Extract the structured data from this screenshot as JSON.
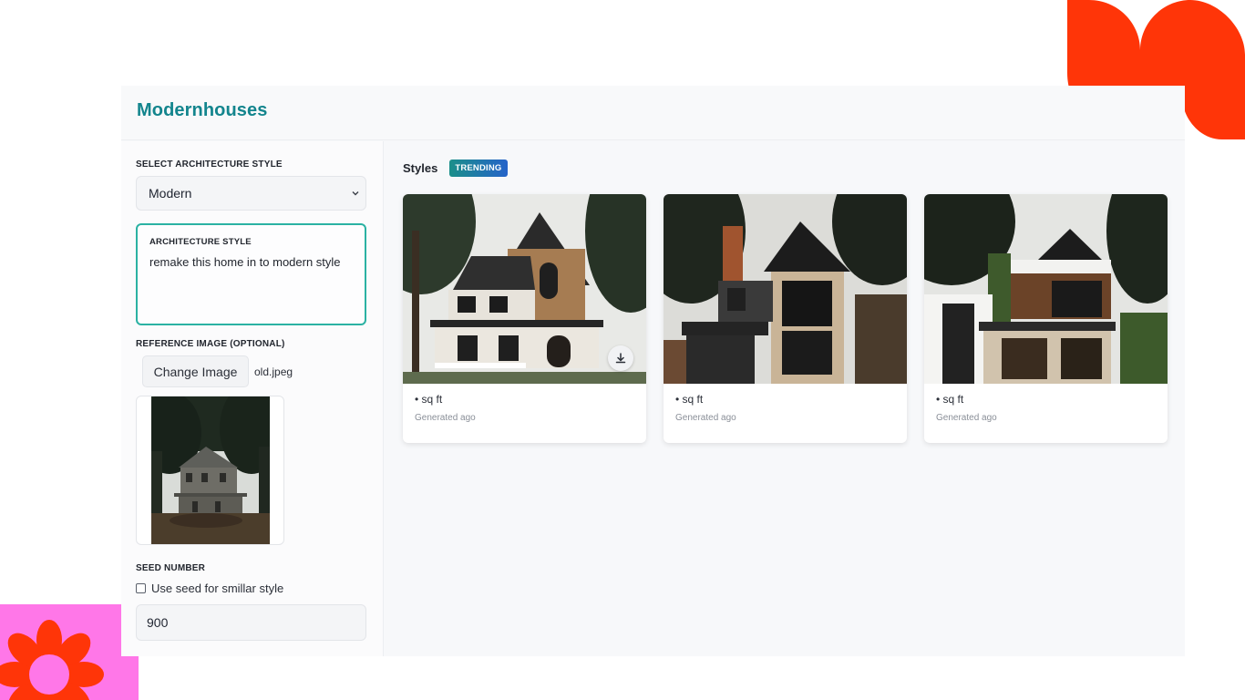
{
  "app": {
    "title": "Modernhouses"
  },
  "sidebar": {
    "style_label": "SELECT ARCHITECTURE STYLE",
    "style_value": "Modern",
    "prompt_label": "ARCHITECTURE STYLE",
    "prompt_text": "remake this home in to modern style",
    "ref_label": "REFERENCE IMAGE (OPTIONAL)",
    "change_button": "Change Image",
    "file_name": "old.jpeg",
    "seed_label": "SEED NUMBER",
    "seed_checkbox_label": "Use seed for smillar style",
    "seed_checked": false,
    "seed_value": "900"
  },
  "main": {
    "title": "Styles",
    "badge": "TRENDING",
    "cards": [
      {
        "sqft": "• sq ft",
        "subtitle": "Generated ago"
      },
      {
        "sqft": "• sq ft",
        "subtitle": "Generated ago"
      },
      {
        "sqft": "• sq ft",
        "subtitle": "Generated ago"
      }
    ]
  },
  "colors": {
    "brand": "#13858d",
    "accent_border": "#2bb2a3",
    "deco_red": "#ff3508",
    "deco_pink": "#ff77e8"
  },
  "icons": [
    "chevron-down-icon",
    "download-icon",
    "flower-icon"
  ]
}
